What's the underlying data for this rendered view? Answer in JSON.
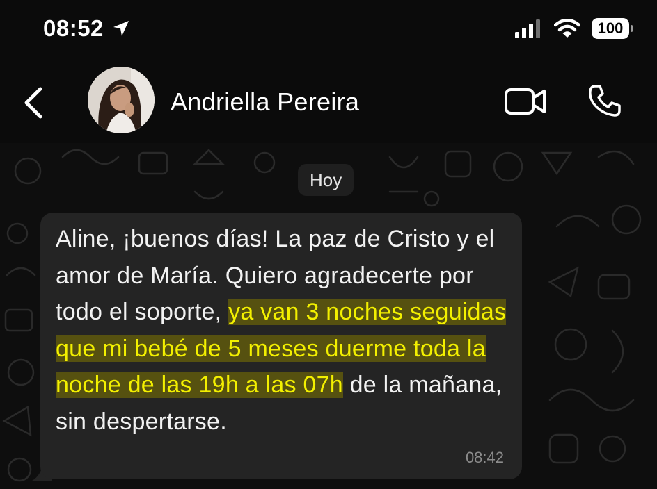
{
  "status_bar": {
    "time": "08:52",
    "battery": "100",
    "icons": [
      "location-arrow-icon",
      "signal-bars-icon",
      "wifi-icon",
      "battery-icon"
    ]
  },
  "header": {
    "contact_name": "Andriella Pereira",
    "icons": [
      "chevron-left-icon",
      "video-camera-icon",
      "phone-icon"
    ]
  },
  "chat": {
    "date_label": "Hoy",
    "message": {
      "text_plain_1": "Aline, ¡buenos días! La paz de Cristo y el amor de María. Quiero agradecerte por todo el soporte, ",
      "text_highlighted": "ya van 3 noches seguidas que mi bebé de 5 meses duerme toda la noche de las 19h a las 07h",
      "text_plain_2": " de la mañana, sin despertarse.",
      "time": "08:42"
    }
  },
  "colors": {
    "background": "#0b0b0b",
    "bubble": "#242424",
    "highlight_text": "#f3f000",
    "highlight_bg": "#807600"
  }
}
